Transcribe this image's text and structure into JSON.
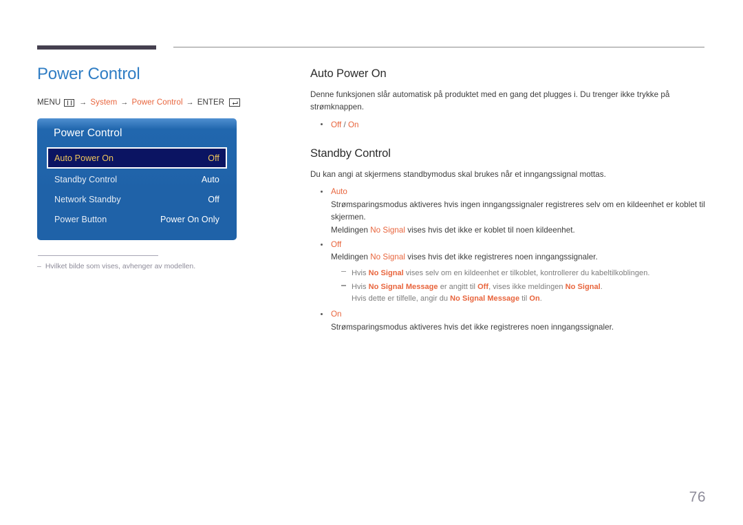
{
  "page": {
    "title": "Power Control",
    "number": "76",
    "title_color": "#2f7dc4",
    "accent_color": "#e8643c"
  },
  "breadcrumb": {
    "menu_label": "MENU",
    "menu_icon": "menu-grid-icon",
    "arrow": "→",
    "step1": "System",
    "step2": "Power Control",
    "enter_label": "ENTER",
    "enter_icon": "enter-key-icon"
  },
  "osd": {
    "title": "Power Control",
    "rows": [
      {
        "label": "Auto Power On",
        "value": "Off",
        "selected": true
      },
      {
        "label": "Standby Control",
        "value": "Auto",
        "selected": false
      },
      {
        "label": "Network Standby",
        "value": "Off",
        "selected": false
      },
      {
        "label": "Power Button",
        "value": "Power On Only",
        "selected": false
      }
    ]
  },
  "footnote": {
    "dash": "–",
    "text": "Hvilket bilde som vises, avhenger av modellen."
  },
  "sections": [
    {
      "heading": "Auto Power On",
      "intro": "Denne funksjonen slår automatisk på produktet med en gang det plugges i. Du trenger ikke trykke på strømknappen.",
      "options": [
        {
          "label_a": "Off",
          "sep": " / ",
          "label_b": "On"
        }
      ]
    },
    {
      "heading": "Standby Control",
      "intro": "Du kan angi at skjermens standbymodus skal brukes når et inngangssignal mottas.",
      "items": {
        "auto": {
          "label": "Auto",
          "line1": "Strømsparingsmodus aktiveres hvis ingen inngangssignaler registreres selv om en kildeenhet er koblet til skjermen.",
          "line2_pre": "Meldingen ",
          "line2_hl": "No Signal",
          "line2_post": " vises hvis det ikke er koblet til noen kildeenhet."
        },
        "off": {
          "label": "Off",
          "line1_pre": "Meldingen ",
          "line1_hl": "No Signal",
          "line1_post": " vises hvis det ikke registreres noen inngangssignaler."
        },
        "on": {
          "label": "On",
          "line1": "Strømsparingsmodus aktiveres hvis det ikke registreres noen inngangssignaler."
        }
      },
      "notes": [
        {
          "pre": "Hvis ",
          "hl1": "No Signal",
          "post": " vises selv om en kildeenhet er tilkoblet, kontrollerer du kabeltilkoblingen."
        },
        {
          "pre": "Hvis ",
          "hl1": "No Signal Message",
          "mid1": " er angitt til ",
          "hl2": "Off",
          "mid2": ", vises ikke meldingen ",
          "hl3": "No Signal",
          "post": ".",
          "sub_pre": "Hvis dette er tilfelle, angir du ",
          "sub_hl1": "No Signal Message",
          "sub_mid": " til ",
          "sub_hl2": "On",
          "sub_post": "."
        }
      ]
    }
  ]
}
